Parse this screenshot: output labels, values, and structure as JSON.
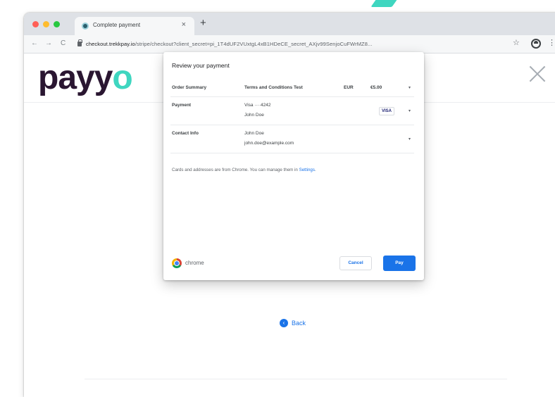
{
  "browser": {
    "tab_title": "Complete payment",
    "tab_close": "×",
    "new_tab": "+",
    "nav_back": "←",
    "nav_forward": "→",
    "nav_reload": "C",
    "url_domain": "checkout.trekkpay.io",
    "url_path": "/stripe/checkout?client_secret=pi_1T4dUF2VUxtgL4xB1HDeCE_secret_AXjv99SenjoCuFWrMZ8...",
    "bookmark_star": "☆",
    "menu": "⋮"
  },
  "page": {
    "logo_text": "payy",
    "logo_accent": "o",
    "back_label": "Back",
    "back_icon": "‹"
  },
  "dialog": {
    "title": "Review your payment",
    "order_summary": {
      "label": "Order Summary",
      "item": "Terms and Conditions Test",
      "currency": "EUR",
      "amount": "€5.00"
    },
    "payment": {
      "label": "Payment",
      "card": "Visa  ····4242",
      "name": "John Doe",
      "brand": "VISA"
    },
    "contact": {
      "label": "Contact Info",
      "name": "John Doe",
      "email": "john.doe@example.com"
    },
    "chevron": "▾",
    "note_text": "Cards and addresses are from Chrome. You can manage them in ",
    "note_link": "Settings",
    "note_end": ".",
    "footer_brand": "chrome",
    "cancel_label": "Cancel",
    "pay_label": "Pay"
  },
  "colors": {
    "accent": "#3fd6c0",
    "logo": "#2a1631",
    "primary_button": "#1a73e8"
  }
}
